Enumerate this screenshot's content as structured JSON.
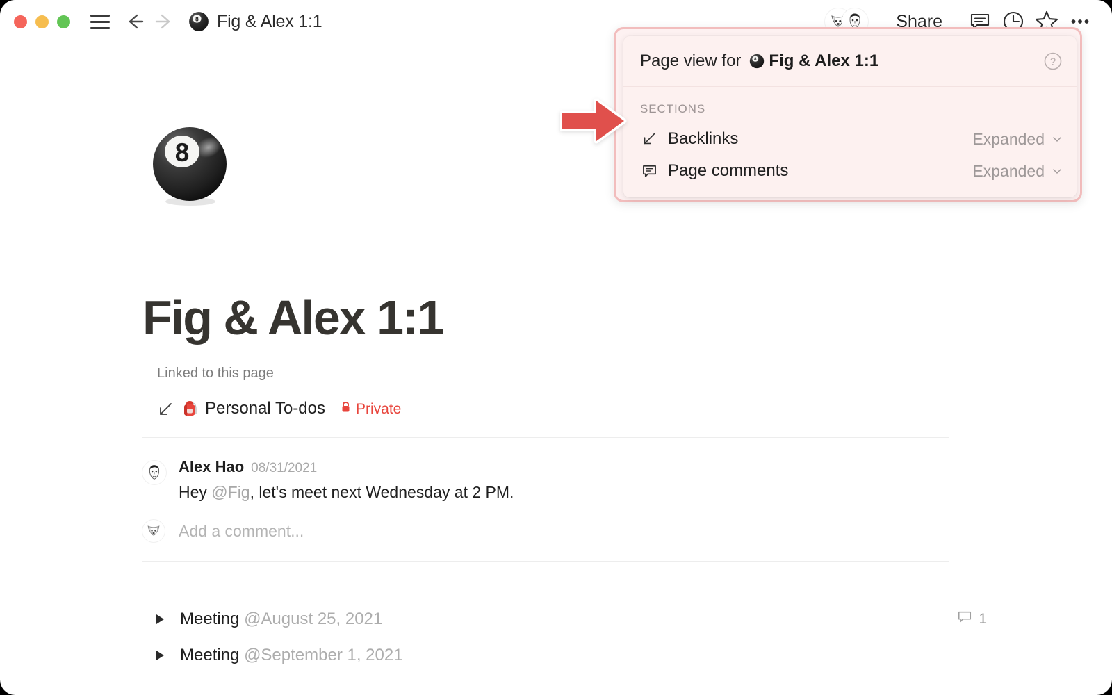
{
  "window": {
    "traffic_lights": [
      "close",
      "minimize",
      "maximize"
    ],
    "colors": {
      "close": "#f5655b",
      "minimize": "#f6bd4f",
      "maximize": "#62c555"
    }
  },
  "titlebar": {
    "menu_icon": "hamburger-icon",
    "back_icon": "arrow-left-icon",
    "forward_icon": "arrow-right-icon",
    "page_emoji": "pool-8-ball-icon",
    "title": "Fig & Alex 1:1"
  },
  "toolbar": {
    "avatars": [
      {
        "name": "dog-face-avatar"
      },
      {
        "name": "person-face-avatar"
      }
    ],
    "share_label": "Share",
    "comment_icon": "comment-icon",
    "history_icon": "clock-icon",
    "favorite_icon": "star-icon",
    "more_icon": "ellipsis-icon"
  },
  "page": {
    "icon": "pool-8-ball-icon",
    "title": "Fig & Alex 1:1",
    "backlinks": {
      "label": "Linked to this page",
      "items": [
        {
          "arrow_icon": "arrow-down-left-icon",
          "emoji": "backpack-icon",
          "title": "Personal To-dos",
          "badge": "Private",
          "badge_icon": "lock-icon",
          "badge_color": "#e8453c"
        }
      ]
    },
    "comments": [
      {
        "avatar": "person-face-avatar",
        "author": "Alex Hao",
        "date": "08/31/2021",
        "text_before_mention": "Hey ",
        "mention": "@Fig",
        "text_after_mention": ", let's meet next Wednesday at 2 PM."
      }
    ],
    "add_comment": {
      "avatar": "dog-face-avatar",
      "placeholder": "Add a comment...",
      "value": ""
    },
    "toggles": [
      {
        "caret_icon": "triangle-right-icon",
        "label": "Meeting ",
        "date_mention": "@August 25, 2021",
        "comment_icon": "comment-icon",
        "comment_count": "1"
      },
      {
        "caret_icon": "triangle-right-icon",
        "label": "Meeting ",
        "date_mention": "@September 1, 2021",
        "comment_icon": "",
        "comment_count": ""
      }
    ]
  },
  "popup": {
    "header_label": "Page view for",
    "header_page_emoji": "pool-8-ball-icon",
    "header_page_name": "Fig & Alex 1:1",
    "help_icon": "question-circle-icon",
    "sections_label": "SECTIONS",
    "sections": [
      {
        "icon": "arrow-down-left-icon",
        "name": "Backlinks",
        "state": "Expanded",
        "chevron_icon": "chevron-down-icon"
      },
      {
        "icon": "comment-icon",
        "name": "Page comments",
        "state": "Expanded",
        "chevron_icon": "chevron-down-icon"
      }
    ],
    "highlight_border_color": "#f2bdbd",
    "background_color": "#fdf1f0"
  },
  "annotation": {
    "arrow_icon": "arrow-right-annotation-icon",
    "arrow_color": "#e0504c"
  }
}
